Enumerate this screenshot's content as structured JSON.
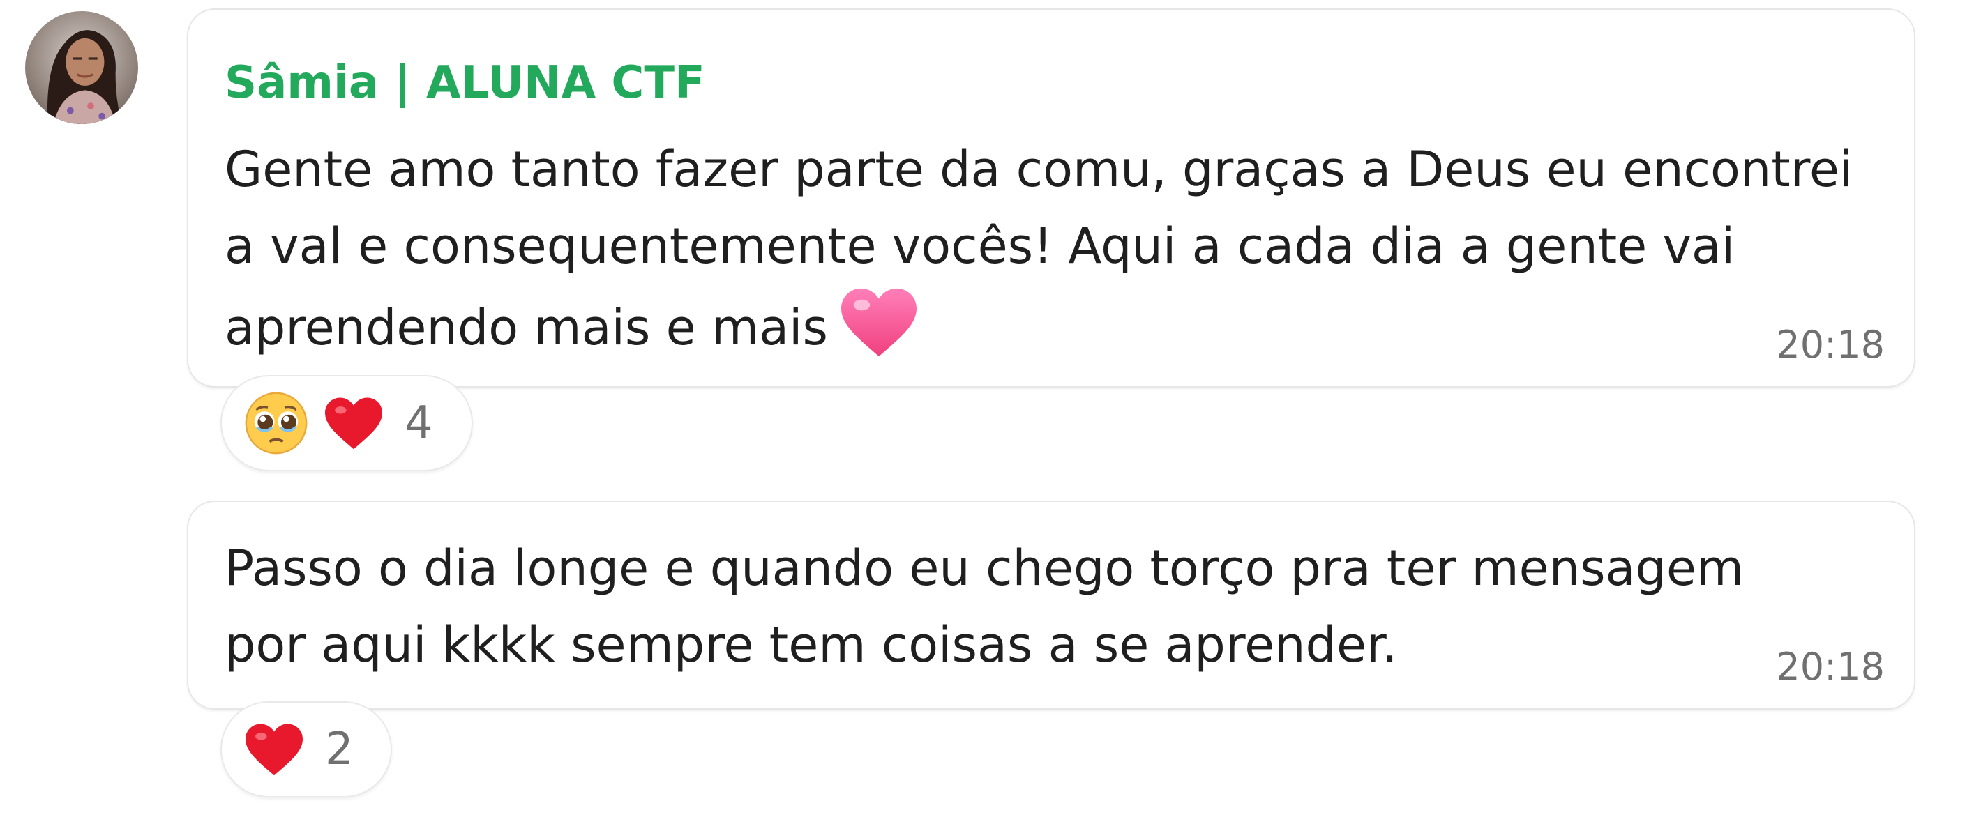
{
  "messages": [
    {
      "sender": "Sâmia | ALUNA CTF",
      "lines": [
        "Gente amo tanto fazer parte da comu, graças a Deus eu encontrei",
        "a val e consequentemente vocês! Aqui a cada dia a gente vai",
        "aprendendo mais e mais"
      ],
      "inline_emoji": "pink-heart",
      "time": "20:18",
      "reactions": {
        "emojis": [
          "pleading-face",
          "red-heart"
        ],
        "count": "4"
      }
    },
    {
      "lines": [
        "Passo o dia longe e quando eu chego torço pra ter mensagem",
        "por aqui kkkk sempre tem coisas a se aprender."
      ],
      "time": "20:18",
      "reactions": {
        "emojis": [
          "red-heart"
        ],
        "count": "2"
      }
    }
  ],
  "colors": {
    "sender_name": "#22a95b",
    "message_text": "#1f1f1f",
    "timestamp": "#707070",
    "bubble_border": "#e6e6e6"
  }
}
